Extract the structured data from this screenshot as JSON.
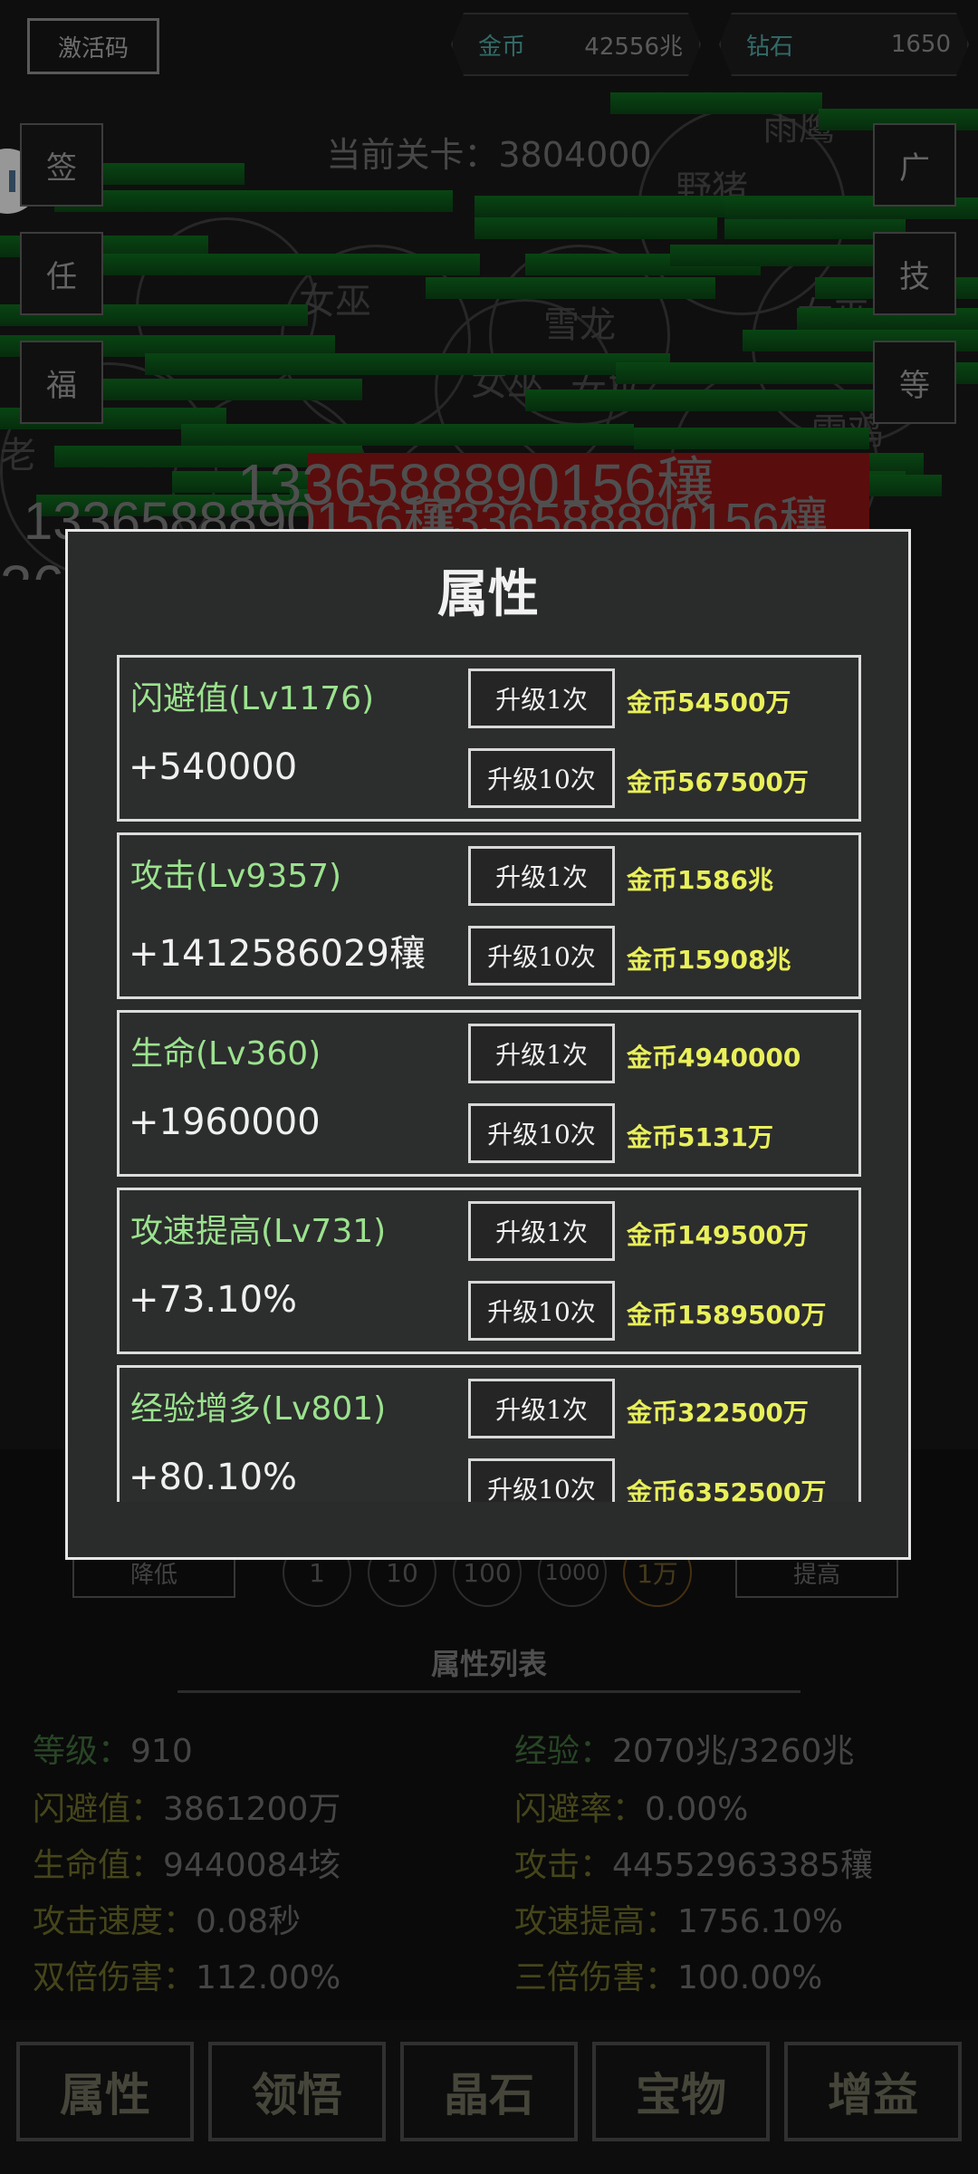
{
  "header": {
    "activation_code": "激活码",
    "gold": {
      "label": "金币",
      "value": "42556兆"
    },
    "diamond": {
      "label": "钻石",
      "value": "1650"
    }
  },
  "battle": {
    "stage_label": "当前关卡：",
    "stage_value": "3804000",
    "enemies": [
      "野猪",
      "雨鹰",
      "女巫",
      "女巫",
      "雪龙",
      "女巫",
      "女巫",
      "雷鸡",
      "老"
    ],
    "damage_numbers": [
      "1336588890156穰",
      "1336588890156穰",
      "1336588890156穰",
      "36"
    ],
    "left_buttons": [
      "签",
      "任",
      "福"
    ],
    "right_buttons": [
      "广",
      "技",
      "等"
    ]
  },
  "modal": {
    "title": "属性",
    "upgrade_once": "升级1次",
    "upgrade_ten": "升级10次",
    "cards": [
      {
        "name": "闪避值",
        "level": "(Lv1176)",
        "bonus": "+540000",
        "cost_label": "金币",
        "cost1": "54500万",
        "cost10": "567500万"
      },
      {
        "name": "攻击",
        "level": "(Lv9357)",
        "bonus": "+1412586029穰",
        "cost_label": "金币",
        "cost1": "1586兆",
        "cost10": "15908兆"
      },
      {
        "name": "生命",
        "level": "(Lv360)",
        "bonus": "+1960000",
        "cost_label": "金币",
        "cost1": "4940000",
        "cost10": "5131万"
      },
      {
        "name": "攻速提高",
        "level": "(Lv731)",
        "bonus": "+73.10%",
        "cost_label": "金币",
        "cost1": "149500万",
        "cost10": "1589500万"
      },
      {
        "name": "经验增多",
        "level": "(Lv801)",
        "bonus": "+80.10%",
        "cost_label": "金币",
        "cost1": "322500万",
        "cost10": "6352500万"
      }
    ]
  },
  "lower": {
    "decrease": "降低",
    "increase": "提高",
    "multipliers": [
      "1",
      "10",
      "100",
      "1000",
      "1万"
    ],
    "attr_list_title": "属性列表",
    "stats_left": [
      {
        "k": "等级：",
        "v": "910"
      },
      {
        "k": "闪避值：",
        "v": "3861200万"
      },
      {
        "k": "生命值：",
        "v": "9440084垓"
      },
      {
        "k": "攻击速度：",
        "v": "0.08秒"
      },
      {
        "k": "双倍伤害：",
        "v": "112.00%"
      }
    ],
    "stats_right": [
      {
        "k": "经验：",
        "v": "2070兆/3260兆"
      },
      {
        "k": "闪避率：",
        "v": "0.00%"
      },
      {
        "k": "攻击：",
        "v": "44552963385穰"
      },
      {
        "k": "攻速提高：",
        "v": "1756.10%"
      },
      {
        "k": "三倍伤害：",
        "v": "100.00%"
      }
    ]
  },
  "tabs": [
    "属性",
    "领悟",
    "晶石",
    "宝物",
    "增益"
  ]
}
